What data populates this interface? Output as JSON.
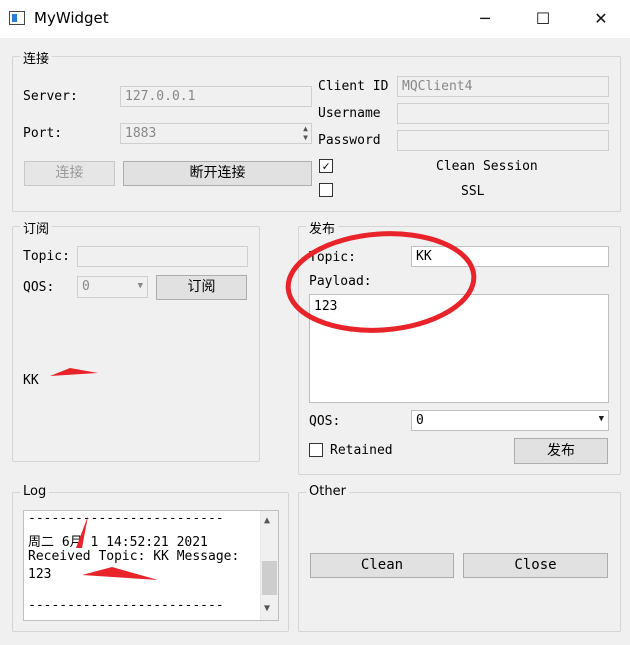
{
  "window": {
    "title": "MyWidget",
    "minimize": "─",
    "maximize": "☐",
    "close": "✕"
  },
  "connect": {
    "group_title": "连接",
    "server_label": "Server:",
    "server_value": "127.0.0.1",
    "port_label": "Port:",
    "port_value": "1883",
    "connect_button": "连接",
    "disconnect_button": "断开连接",
    "client_id_label": "Client ID",
    "client_id_value": "MQClient4",
    "username_label": "Username",
    "username_value": "",
    "password_label": "Password",
    "password_value": "",
    "clean_session_label": "Clean Session",
    "clean_session_checked": true,
    "ssl_label": "SSL",
    "ssl_checked": false
  },
  "subscribe": {
    "group_title": "订阅",
    "topic_label": "Topic:",
    "topic_value": "",
    "qos_label": "QOS:",
    "qos_value": "0",
    "subscribe_button": "订阅",
    "received_topic": "KK"
  },
  "publish": {
    "group_title": "发布",
    "topic_label": "Topic:",
    "topic_value": "KK",
    "payload_label": "Payload:",
    "payload_value": "123",
    "qos_label": "QOS:",
    "qos_value": "0",
    "retained_label": "Retained",
    "retained_checked": false,
    "publish_button": "发布"
  },
  "log": {
    "group_title": "Log",
    "lines": [
      "-------------------------",
      "周二 6月 1 14:52:21 2021",
      "Received Topic: KK Message:",
      "123",
      "",
      "-------------------------"
    ]
  },
  "other": {
    "group_title": "Other",
    "clean_button": "Clean",
    "close_button": "Close"
  },
  "annotation_color": "#e8232a"
}
